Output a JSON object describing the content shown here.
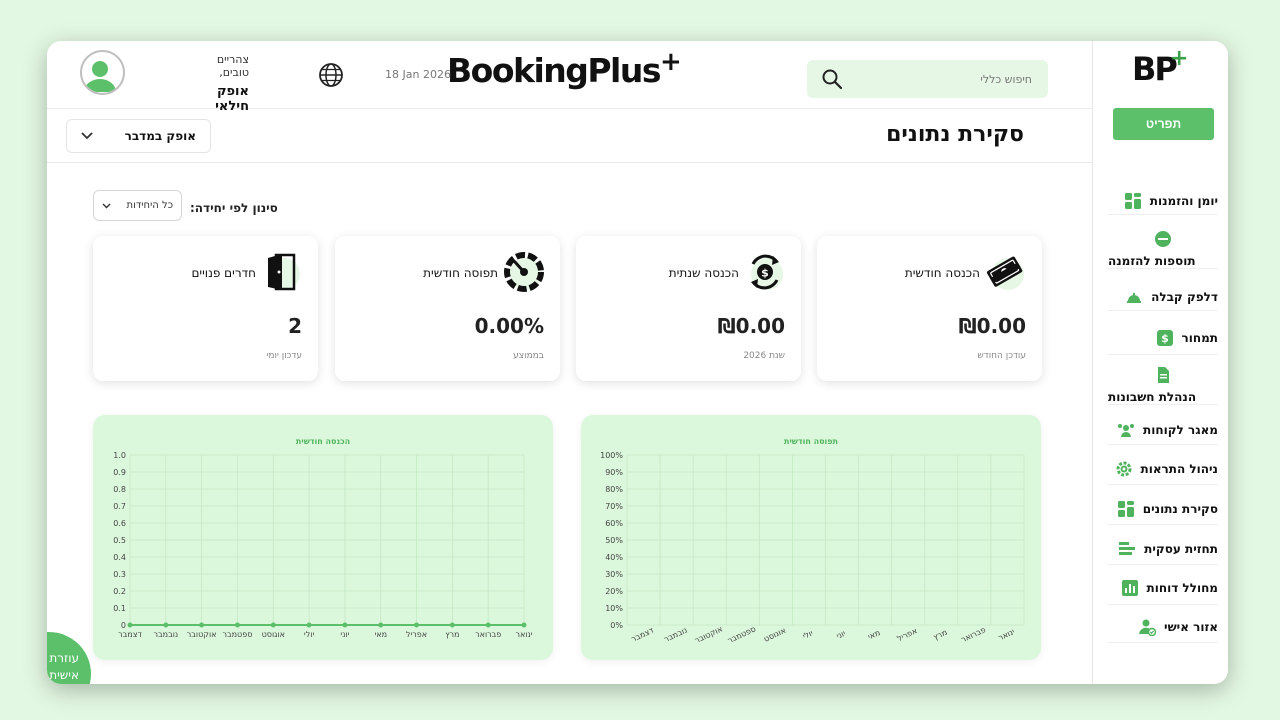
{
  "sidebar": {
    "menu_button": "תפריט",
    "items": [
      {
        "label": "יומן והזמנות",
        "icon": "calendar-grid-icon"
      },
      {
        "label": "תוספות להזמנה",
        "icon": "extras-badge-icon"
      },
      {
        "label": "דלפק קבלה",
        "icon": "reception-bell-icon"
      },
      {
        "label": "תמחור",
        "icon": "pricing-dollar-icon"
      },
      {
        "label": "הנהלת חשבונות",
        "icon": "document-icon"
      },
      {
        "label": "מאגר לקוחות",
        "icon": "customers-icon"
      },
      {
        "label": "ניהול התראות",
        "icon": "gear-icon"
      },
      {
        "label": "סקירת נתונים",
        "icon": "dashboard-grid-icon"
      },
      {
        "label": "תחזית עסקית",
        "icon": "forecast-bars-icon"
      },
      {
        "label": "מחולל דוחות",
        "icon": "report-chart-icon"
      },
      {
        "label": "אזור אישי",
        "icon": "user-check-icon"
      }
    ]
  },
  "header": {
    "brand": "BookingPlus",
    "date": "18 Jan 2026",
    "search_placeholder": "חיפוש כללי",
    "greeting": "צהריים טובים,",
    "user_name": "אופק חילאי"
  },
  "subbar": {
    "title": "סקירת נתונים",
    "user_select": "אופק במדבר"
  },
  "filter": {
    "label": "סינון לפי יחידה:",
    "value": "כל היחידות"
  },
  "cards": [
    {
      "title": "הכנסה חודשית",
      "value": "₪0.00",
      "sub": "עודכן החודש",
      "icon": "money-bills-icon"
    },
    {
      "title": "הכנסה שנתית",
      "value": "₪0.00",
      "sub": "שנת 2026",
      "icon": "money-cycle-icon"
    },
    {
      "title": "תפוסה חודשית",
      "value": "0.00%",
      "sub": "בממוצע",
      "icon": "gauge-icon"
    },
    {
      "title": "חדרים פנויים",
      "value": "2",
      "sub": "עדכון יומי",
      "icon": "door-icon"
    }
  ],
  "help": {
    "label": "עוזרת אישית"
  },
  "chart_data": [
    {
      "type": "line",
      "title": "הכנסה חודשית",
      "categories": [
        "ינואר",
        "פברואר",
        "מרץ",
        "אפריל",
        "מאי",
        "יוני",
        "יולי",
        "אוגוסט",
        "ספטמבר",
        "אוקטובר",
        "נובמבר",
        "דצמבר"
      ],
      "values": [
        0,
        0,
        0,
        0,
        0,
        0,
        0,
        0,
        0,
        0,
        0,
        0
      ],
      "ylim": [
        0,
        1
      ],
      "yticks": [
        "1.0",
        "0.9",
        "0.8",
        "0.7",
        "0.6",
        "0.5",
        "0.4",
        "0.3",
        "0.2",
        "0.1",
        "0"
      ],
      "grid": true,
      "color": "#5cc06b"
    },
    {
      "type": "bar",
      "title": "תפוסה חודשית",
      "categories": [
        "ינואר",
        "פברואר",
        "מרץ",
        "אפריל",
        "מאי",
        "יוני",
        "יולי",
        "אוגוסט",
        "ספטמבר",
        "אוקטובר",
        "נובמבר",
        "דצמבר"
      ],
      "values": [
        0,
        0,
        0,
        0,
        0,
        0,
        0,
        0,
        0,
        0,
        0,
        0
      ],
      "ylim": [
        0,
        100
      ],
      "yticks": [
        "100%",
        "90%",
        "80%",
        "70%",
        "60%",
        "50%",
        "40%",
        "30%",
        "20%",
        "10%",
        "0%"
      ],
      "grid": true,
      "color": "#5cc06b"
    }
  ]
}
